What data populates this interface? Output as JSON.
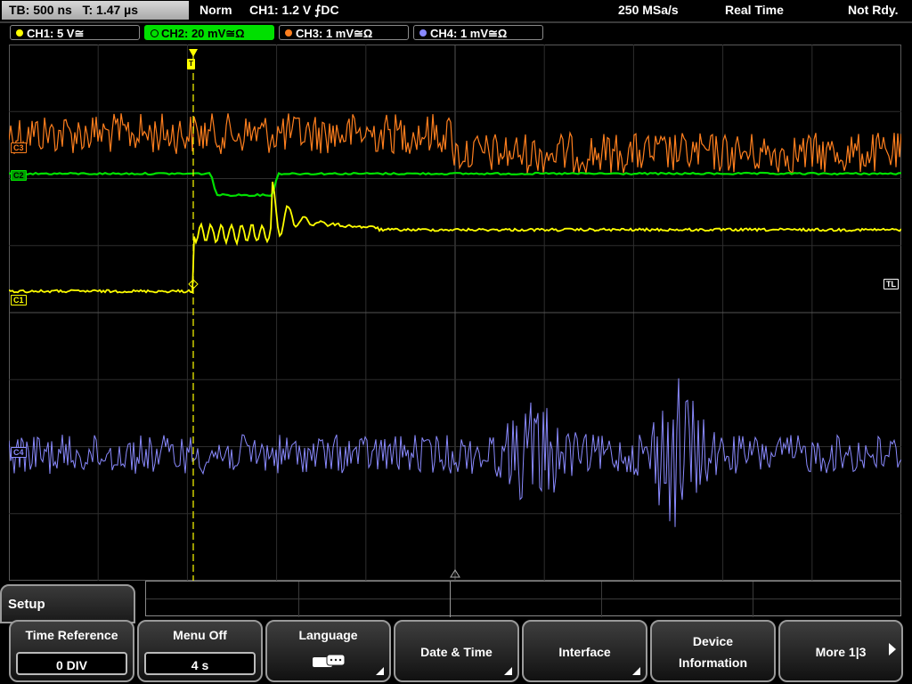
{
  "status": {
    "timebase": "TB: 500 ns",
    "trigger_time": "T: 1.47 µs",
    "acq_mode": "Norm",
    "trigger_info": "CH1: 1.2 V ⨍DC",
    "sample_rate": "250 MSa/s",
    "mode": "Real Time",
    "state": "Not Rdy."
  },
  "channels": [
    {
      "label": "CH1: 5 V≅",
      "color": "#ffff00"
    },
    {
      "label": "CH2: 20 mV≅Ω",
      "color": "#00e000"
    },
    {
      "label": "CH3: 1 mV≅Ω",
      "color": "#ff7f1e"
    },
    {
      "label": "CH4: 1 mV≅Ω",
      "color": "#8888ff"
    }
  ],
  "markers": {
    "c1": "C1",
    "c2": "C2",
    "c3": "C3",
    "c4": "C4",
    "tl": "TL",
    "trigger_pos": "T"
  },
  "menu": {
    "title": "Setup",
    "keys": [
      {
        "label": "Time Reference",
        "value": "0 DIV"
      },
      {
        "label": "Menu Off",
        "value": "4 s"
      },
      {
        "label": "Language",
        "icon": "keyboard-icon"
      },
      {
        "label": "Date & Time"
      },
      {
        "label": "Interface"
      },
      {
        "label": "Device Information",
        "line1": "Device",
        "line2": "Information"
      },
      {
        "label": "More 1|3"
      }
    ]
  }
}
